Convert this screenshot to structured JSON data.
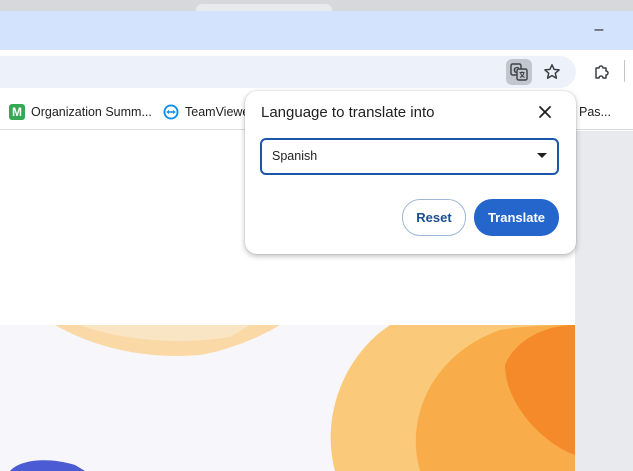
{
  "window": {
    "minimize_label": "–"
  },
  "bookmarks": [
    {
      "label": "Organization Summ...",
      "icon": "green-m-icon",
      "icon_letter": "M"
    },
    {
      "label": "TeamViewe",
      "icon": "teamviewer-icon"
    },
    {
      "label": "Pas...",
      "icon": ""
    }
  ],
  "translate_popup": {
    "title": "Language to translate into",
    "selected_language": "Spanish",
    "reset_label": "Reset",
    "translate_label": "Translate"
  },
  "colors": {
    "titlebar": "#d3e3fd",
    "accent": "#2566cc",
    "select_border": "#1a57a8",
    "art_orange": "#f5a23a",
    "art_blue": "#4a5bd4"
  }
}
